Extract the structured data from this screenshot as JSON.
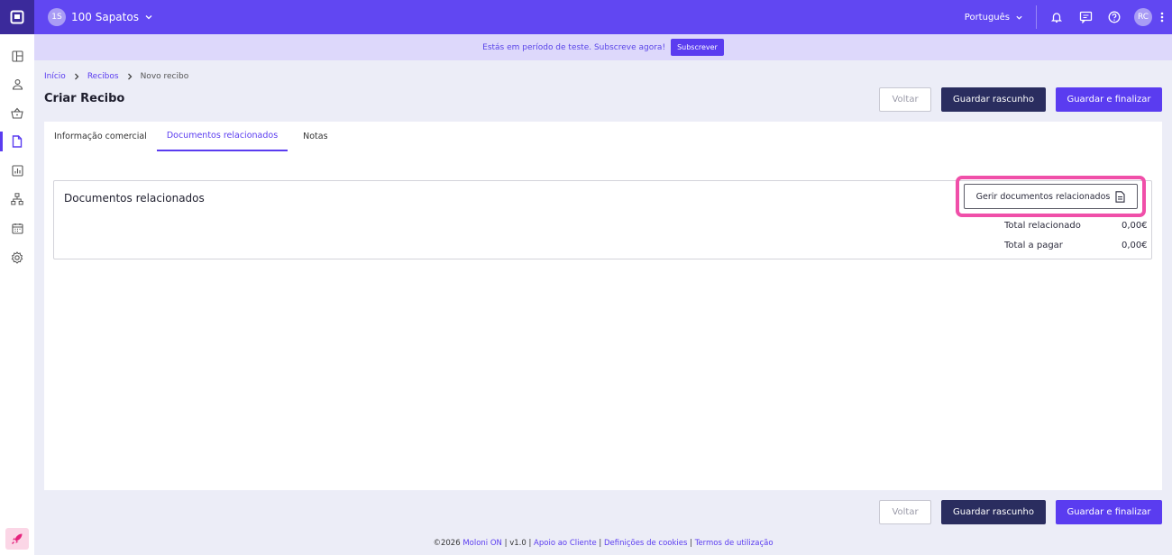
{
  "topbar": {
    "company_initials": "1S",
    "company_name": "100 Sapatos",
    "language": "Português",
    "user_initials": "RC"
  },
  "trial_banner": {
    "text": "Estás em período de teste. Subscreve agora!",
    "button": "Subscrever"
  },
  "sidebar": {
    "items": [
      {
        "icon": "dashboard-icon"
      },
      {
        "icon": "user-icon"
      },
      {
        "icon": "basket-icon"
      },
      {
        "icon": "document-icon",
        "active": true
      },
      {
        "icon": "chart-icon"
      },
      {
        "icon": "network-icon"
      },
      {
        "icon": "calendar-icon"
      },
      {
        "icon": "settings-icon"
      }
    ]
  },
  "breadcrumb": {
    "items": [
      "Início",
      "Recibos",
      "Novo recibo"
    ]
  },
  "page": {
    "title": "Criar Recibo"
  },
  "actions": {
    "back": "Voltar",
    "save_draft": "Guardar rascunho",
    "save_finalize": "Guardar e finalizar"
  },
  "tabs": [
    {
      "label": "Informação comercial",
      "active": false
    },
    {
      "label": "Documentos relacionados",
      "active": true
    },
    {
      "label": "Notas",
      "active": false
    }
  ],
  "related_docs": {
    "title": "Documentos relacionados",
    "manage_button": "Gerir documentos relacionados",
    "totals": [
      {
        "label": "Total relacionado",
        "value": "0,00€"
      },
      {
        "label": "Total a pagar",
        "value": "0,00€"
      }
    ]
  },
  "footer": {
    "copyright": "©2026",
    "brand": "Moloni ON",
    "version": "v1.0",
    "support": "Apoio ao Cliente",
    "cookies": "Definições de cookies",
    "terms": "Termos de utilização"
  },
  "colors": {
    "primary": "#5a3cf0",
    "topbar": "#6147f2",
    "dark_button": "#2a2d5f",
    "highlight": "#f04fa9"
  }
}
